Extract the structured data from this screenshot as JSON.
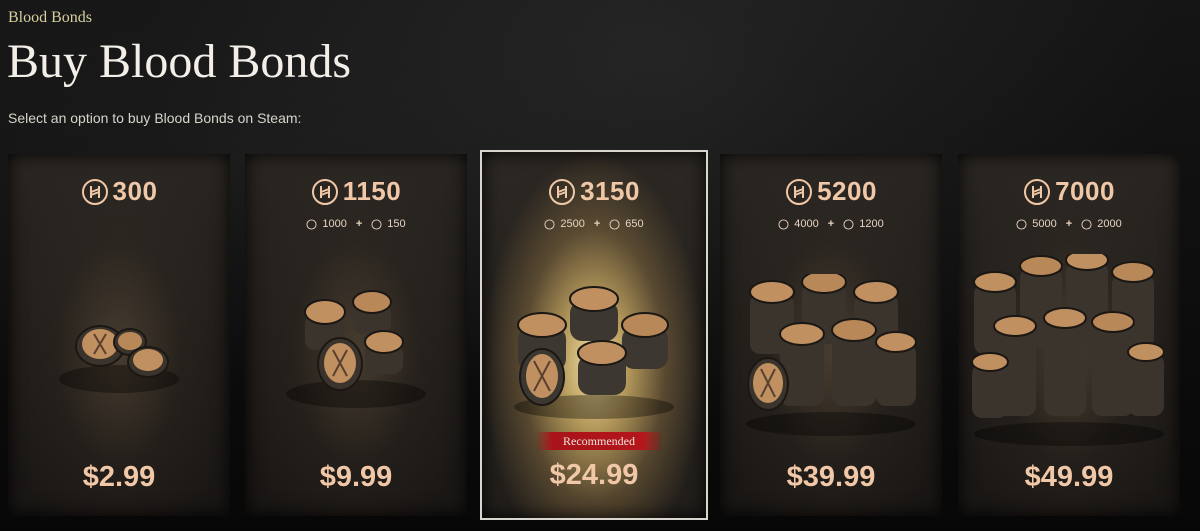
{
  "header": {
    "breadcrumb": "Blood Bonds",
    "title": "Buy Blood Bonds",
    "subtitle": "Select an option to buy Blood Bonds on Steam:"
  },
  "colors": {
    "accent": "#f0c8a8",
    "breadcrumb": "#d6cf9e",
    "recommended_badge": "#b5161c"
  },
  "cards": [
    {
      "amount": "300",
      "base": "",
      "bonus": "",
      "price": "$2.99",
      "badge": ""
    },
    {
      "amount": "1150",
      "base": "1000",
      "bonus": "150",
      "price": "$9.99",
      "badge": ""
    },
    {
      "amount": "3150",
      "base": "2500",
      "bonus": "650",
      "price": "$24.99",
      "badge": "Recommended"
    },
    {
      "amount": "5200",
      "base": "4000",
      "bonus": "1200",
      "price": "$39.99",
      "badge": ""
    },
    {
      "amount": "7000",
      "base": "5000",
      "bonus": "2000",
      "price": "$49.99",
      "badge": ""
    }
  ],
  "icons": {
    "currency": "blood-bond-coin-icon"
  }
}
